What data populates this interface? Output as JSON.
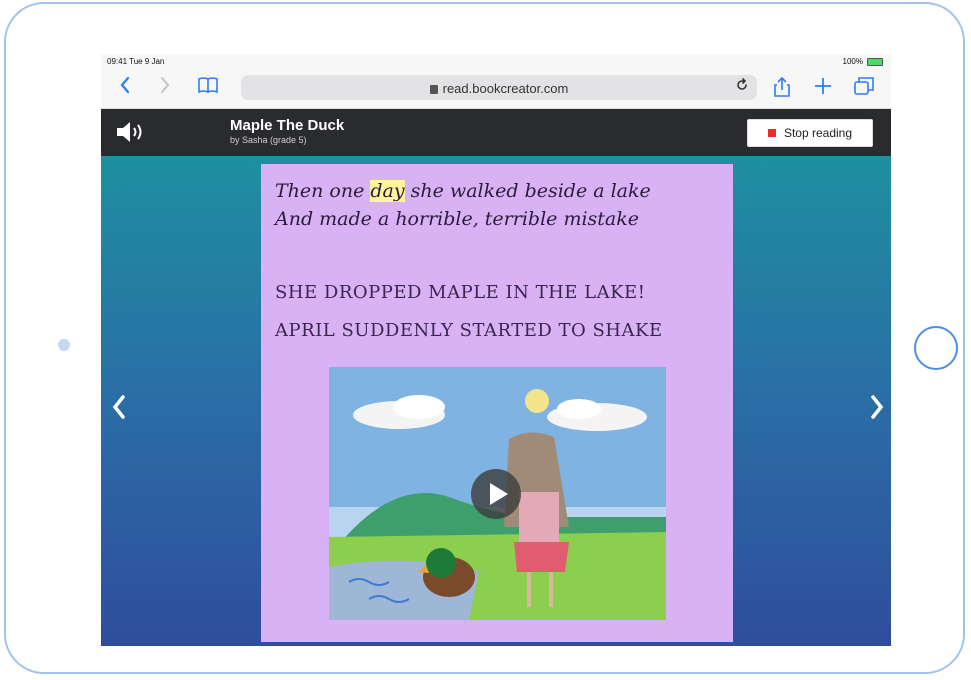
{
  "status_bar": {
    "time": "09:41  Tue 9 Jan",
    "battery": "100%"
  },
  "browser": {
    "back_icon": "chevron-left-icon",
    "forward_icon": "chevron-right-icon",
    "bookmarks_icon": "book-icon",
    "url": "read.bookcreator.com",
    "reload_icon": "reload-icon",
    "share_icon": "share-icon",
    "new_tab_icon": "plus-icon",
    "tabs_icon": "tabs-icon"
  },
  "reader": {
    "title": "Maple The Duck",
    "byline": "by Sasha (grade 5)",
    "stop_label": "Stop reading",
    "speaker_icon": "speaker-icon",
    "prev_icon": "chevron-left-icon",
    "next_icon": "chevron-right-icon"
  },
  "page": {
    "line1_before": "Then one ",
    "line1_highlight": "day",
    "line1_after": " she walked beside a lake",
    "line2": "And made a horrible, terrible mistake",
    "line3": "SHE DROPPED MAPLE IN THE LAKE!",
    "line4": "APRIL SUDDENLY STARTED TO SHAKE",
    "play_icon": "play-icon"
  },
  "colors": {
    "accent": "#2f7cf6",
    "header": "#2a2b2e",
    "page": "#d8b2f5",
    "stop": "#e3302f",
    "highlight": "#fff59d"
  }
}
